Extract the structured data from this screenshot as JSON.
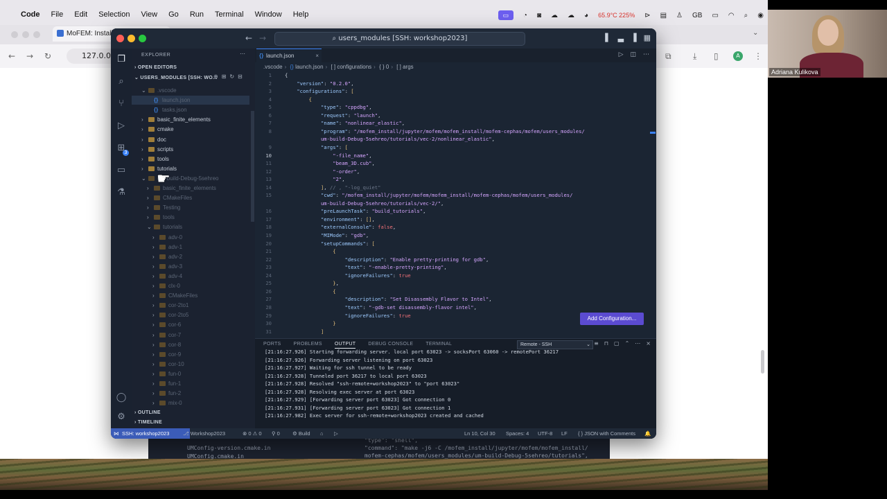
{
  "macos": {
    "apple_glyph": "",
    "app_name": "Code",
    "menus": [
      "File",
      "Edit",
      "Selection",
      "View",
      "Go",
      "Run",
      "Terminal",
      "Window",
      "Help"
    ],
    "status_temp": "65.9°C 225%",
    "status_kb": "GB"
  },
  "browser": {
    "tab_title": "MoFEM: Install",
    "address": "127.0.0."
  },
  "video_call": {
    "participant_name": "Adriana Kulikova"
  },
  "vscode": {
    "command_center": "users_modules [SSH: workshop2023]",
    "explorer": {
      "title": "EXPLORER",
      "open_editors": "OPEN EDITORS",
      "workspace": "USERS_MODULES [SSH: WO...",
      "items": [
        {
          "label": ".vscode",
          "kind": "folder-open",
          "dim": true
        },
        {
          "label": "launch.json",
          "kind": "json",
          "dim": true,
          "selected": true
        },
        {
          "label": "tasks.json",
          "kind": "json",
          "dim": true
        },
        {
          "label": "basic_finite_elements",
          "kind": "folder"
        },
        {
          "label": "cmake",
          "kind": "folder"
        },
        {
          "label": "doc",
          "kind": "folder"
        },
        {
          "label": "scripts",
          "kind": "folder"
        },
        {
          "label": "tools",
          "kind": "folder"
        },
        {
          "label": "tutorials",
          "kind": "folder"
        },
        {
          "label": "um-build-Debug-5sehreo",
          "kind": "folder-open",
          "dim": true
        },
        {
          "label": "basic_finite_elements",
          "kind": "folder",
          "dim": true
        },
        {
          "label": "CMakeFiles",
          "kind": "folder",
          "dim": true
        },
        {
          "label": "Testing",
          "kind": "folder",
          "dim": true
        },
        {
          "label": "tools",
          "kind": "folder",
          "dim": true
        },
        {
          "label": "tutorials",
          "kind": "folder-open",
          "dim": true
        },
        {
          "label": "adv-0",
          "kind": "folder",
          "dim": true
        },
        {
          "label": "adv-1",
          "kind": "folder",
          "dim": true
        },
        {
          "label": "adv-2",
          "kind": "folder",
          "dim": true
        },
        {
          "label": "adv-3",
          "kind": "folder",
          "dim": true
        },
        {
          "label": "adv-4",
          "kind": "folder",
          "dim": true
        },
        {
          "label": "clx-0",
          "kind": "folder",
          "dim": true
        },
        {
          "label": "CMakeFiles",
          "kind": "folder",
          "dim": true
        },
        {
          "label": "cor-2to1",
          "kind": "folder",
          "dim": true
        },
        {
          "label": "cor-2to5",
          "kind": "folder",
          "dim": true
        },
        {
          "label": "cor-6",
          "kind": "folder",
          "dim": true
        },
        {
          "label": "cor-7",
          "kind": "folder",
          "dim": true
        },
        {
          "label": "cor-8",
          "kind": "folder",
          "dim": true
        },
        {
          "label": "cor-9",
          "kind": "folder",
          "dim": true
        },
        {
          "label": "cor-10",
          "kind": "folder",
          "dim": true
        },
        {
          "label": "fun-0",
          "kind": "folder",
          "dim": true
        },
        {
          "label": "fun-1",
          "kind": "folder",
          "dim": true
        },
        {
          "label": "fun-2",
          "kind": "folder",
          "dim": true
        },
        {
          "label": "mix-0",
          "kind": "folder",
          "dim": true
        }
      ],
      "outline": "OUTLINE",
      "timeline": "TIMELINE"
    },
    "editor": {
      "tab_label": "launch.json",
      "breadcrumb": [
        ".vscode",
        "launch.json",
        "[ ] configurations",
        "{ } 0",
        "[ ] args"
      ],
      "current_line": 10,
      "lines": [
        {
          "n": 1,
          "html": "{"
        },
        {
          "n": 2,
          "html": "    <span class='k'>\"version\"</span>: <span class='s'>\"0.2.0\"</span>,"
        },
        {
          "n": 3,
          "html": "    <span class='k'>\"configurations\"</span>: <span class='br'>[</span>"
        },
        {
          "n": 4,
          "html": "        <span class='br'>{</span>"
        },
        {
          "n": 5,
          "html": "            <span class='k'>\"type\"</span>: <span class='s'>\"cppdbg\"</span>,"
        },
        {
          "n": 6,
          "html": "            <span class='k'>\"request\"</span>: <span class='s'>\"launch\"</span>,"
        },
        {
          "n": 7,
          "html": "            <span class='k'>\"name\"</span>: <span class='s'>\"nonlinear_elastic\"</span>,"
        },
        {
          "n": 8,
          "html": "            <span class='k'>\"program\"</span>: <span class='s'>\"/mofem_install/jupyter/mofem/mofem_install/mofem-cephas/mofem/users_modules/</span>"
        },
        {
          "n": null,
          "html": "            <span class='s'>um-build-Debug-5sehreo/tutorials/vec-2/nonlinear_elastic\"</span>,"
        },
        {
          "n": 9,
          "html": "            <span class='k'>\"args\"</span>: <span class='br'>[</span>"
        },
        {
          "n": 10,
          "html": "                <span class='s'>\"-file_name\"</span>,"
        },
        {
          "n": 11,
          "html": "                <span class='s'>\"beam_3D.cub\"</span>,"
        },
        {
          "n": 12,
          "html": "                <span class='s'>\"-order\"</span>,"
        },
        {
          "n": 13,
          "html": "                <span class='s'>\"2\"</span>,"
        },
        {
          "n": 14,
          "html": "            <span class='br'>]</span>, <span class='cm'>// , \"-log_quiet\"</span>"
        },
        {
          "n": 15,
          "html": "            <span class='k'>\"cwd\"</span>: <span class='s'>\"/mofem_install/jupyter/mofem/mofem_install/mofem-cephas/mofem/users_modules/</span>"
        },
        {
          "n": null,
          "html": "            <span class='s'>um-build-Debug-5sehreo/tutorials/vec-2/\"</span>,"
        },
        {
          "n": 16,
          "html": "            <span class='k'>\"preLaunchTask\"</span>: <span class='s'>\"build_tutorials\"</span>,"
        },
        {
          "n": 17,
          "html": "            <span class='k'>\"environment\"</span>: <span class='br'>[]</span>,"
        },
        {
          "n": 18,
          "html": "            <span class='k'>\"externalConsole\"</span>: <span class='bo'>false</span>,"
        },
        {
          "n": 19,
          "html": "            <span class='k'>\"MIMode\"</span>: <span class='s'>\"gdb\"</span>,"
        },
        {
          "n": 20,
          "html": "            <span class='k'>\"setupCommands\"</span>: <span class='br'>[</span>"
        },
        {
          "n": 21,
          "html": "                <span class='br'>{</span>"
        },
        {
          "n": 22,
          "html": "                    <span class='k'>\"description\"</span>: <span class='s'>\"Enable pretty-printing for gdb\"</span>,"
        },
        {
          "n": 23,
          "html": "                    <span class='k'>\"text\"</span>: <span class='s'>\"-enable-pretty-printing\"</span>,"
        },
        {
          "n": 24,
          "html": "                    <span class='k'>\"ignoreFailures\"</span>: <span class='bo'>true</span>"
        },
        {
          "n": 25,
          "html": "                <span class='br'>}</span>,"
        },
        {
          "n": 26,
          "html": "                <span class='br'>{</span>"
        },
        {
          "n": 27,
          "html": "                    <span class='k'>\"description\"</span>: <span class='s'>\"Set Disassembly Flavor to Intel\"</span>,"
        },
        {
          "n": 28,
          "html": "                    <span class='k'>\"text\"</span>: <span class='s'>\"-gdb-set disassembly-flavor intel\"</span>,"
        },
        {
          "n": 29,
          "html": "                    <span class='k'>\"ignoreFailures\"</span>: <span class='bo'>true</span>"
        },
        {
          "n": 30,
          "html": "                <span class='br'>}</span>"
        },
        {
          "n": 31,
          "html": "            <span class='br'>]</span>"
        }
      ],
      "add_configuration": "Add Configuration..."
    },
    "panel": {
      "tabs": [
        "PORTS",
        "PROBLEMS",
        "OUTPUT",
        "DEBUG CONSOLE",
        "TERMINAL"
      ],
      "active_tab": "OUTPUT",
      "channel": "Remote - SSH",
      "output_lines": [
        "[21:16:27.926] Starting forwarding server. local port 63023 -> socksPort 63060 -> remotePort 36217",
        "[21:16:27.926] Forwarding server listening on port 63023",
        "[21:16:27.927] Waiting for ssh tunnel to be ready",
        "[21:16:27.928] Tunneled port 36217 to local port 63023",
        "[21:16:27.928] Resolved \"ssh-remote+workshop2023\" to \"port 63023\"",
        "[21:16:27.928] Resolving exec server at port 63023",
        "[21:16:27.929] [Forwarding server port 63023] Got connection 0",
        "[21:16:27.931] [Forwarding server port 63023] Got connection 1",
        "[21:16:27.982] Exec server for ssh-remote+workshop2023 created and cached"
      ]
    },
    "status": {
      "remote": "SSH: workshop2023",
      "workspace": "Workshop2023",
      "errors": "⊗ 0 ⚠ 0",
      "ports": "⚲ 0",
      "build": "Build",
      "position": "Ln 10, Col 30",
      "spaces": "Spaces: 4",
      "encoding": "UTF-8",
      "eol": "LF",
      "language": "JSON with Comments"
    }
  },
  "background_window": {
    "files": [
      "UMConfig-version.cmake.in",
      "UMConfig.cmake.in"
    ],
    "code_lines": [
      "\"type\": \"shell\",",
      "\"command\": \"make -j6 -C /mofem_install/jupyter/mofem/mofem_install/",
      "mofem-cephas/mofem/users_modules/um-build-Debug-5sehreo/tutorials\","
    ]
  }
}
